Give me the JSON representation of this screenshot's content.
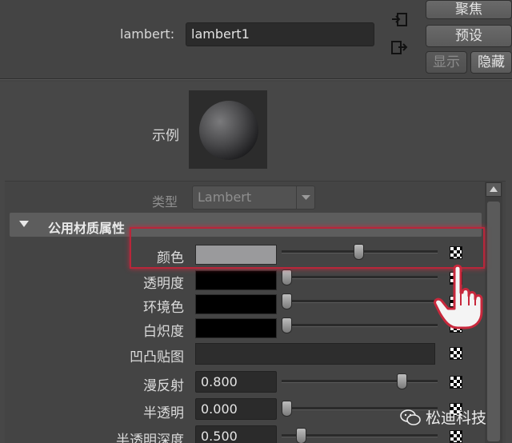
{
  "header": {
    "node_label": "lambert:",
    "node_value": "lambert1",
    "buttons": {
      "focus": "聚焦",
      "presets": "预设",
      "show": "显示",
      "hide": "隐藏"
    }
  },
  "swatch": {
    "label": "示例"
  },
  "type_row": {
    "label": "类型",
    "value": "Lambert"
  },
  "section": {
    "title": "公用材质属性"
  },
  "attributes": {
    "color": {
      "label": "颜色",
      "swatch": "#9a9a9c",
      "slider": 0.49
    },
    "transparency": {
      "label": "透明度",
      "swatch": "#000000",
      "slider": 0.0
    },
    "ambient": {
      "label": "环境色",
      "swatch": "#000000",
      "slider": 0.0
    },
    "incandescence": {
      "label": "白炽度",
      "swatch": "#000000",
      "slider": 0.0
    },
    "bump": {
      "label": "凹凸贴图"
    },
    "diffuse": {
      "label": "漫反射",
      "value": "0.800",
      "slider": 0.8
    },
    "translucence": {
      "label": "半透明",
      "value": "0.000",
      "slider": 0.0
    },
    "translucence_depth": {
      "label": "半透明深度",
      "value": "0.500",
      "slider": 0.1
    }
  },
  "watermark": {
    "text": "松迪科技"
  },
  "colors": {
    "highlight": "#b8263a",
    "background": "#444444"
  }
}
